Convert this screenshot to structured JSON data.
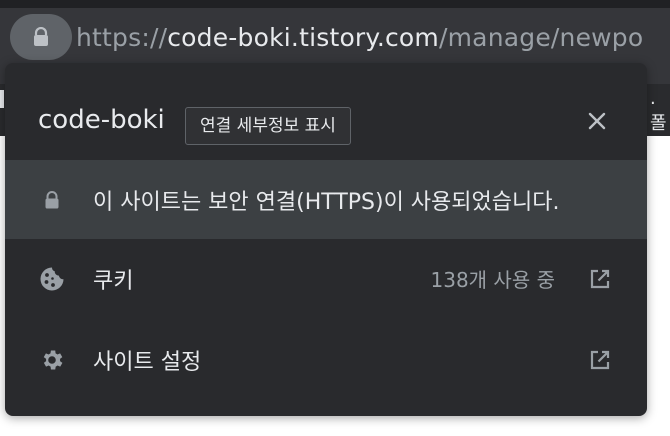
{
  "address_bar": {
    "scheme": "https://",
    "host": "code-boki.tistory.com",
    "path": "/manage/newpo"
  },
  "background": {
    "right_glyph": ". 폴"
  },
  "site_info_popup": {
    "site_name": "code-boki",
    "tooltip": "연결 세부정보 표시",
    "security_message": "이 사이트는 보안 연결(HTTPS)이 사용되었습니다.",
    "cookies_label": "쿠키",
    "cookies_count": "138개 사용 중",
    "site_settings_label": "사이트 설정"
  },
  "colors": {
    "popup_bg": "#292a2d",
    "row_highlight": "#3c4043",
    "text_primary": "#e8eaed",
    "text_secondary": "#9aa0a6",
    "icon": "#9aa0a6"
  },
  "icons": {
    "address_lock": "lock-icon",
    "close": "close-icon",
    "security": "lock-icon",
    "cookies": "cookie-icon",
    "settings": "gear-icon",
    "external": "open-in-new-icon"
  }
}
